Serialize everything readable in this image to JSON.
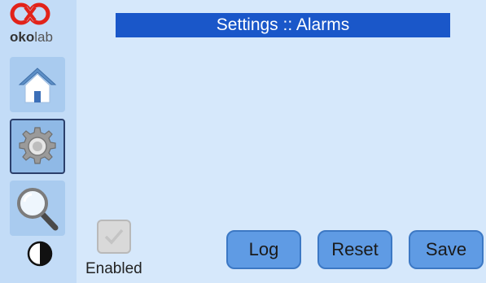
{
  "brand": {
    "name_bold": "oko",
    "name_light": "lab",
    "color": "#e2231a"
  },
  "header": {
    "title": "Settings :: Alarms"
  },
  "sidebar": {
    "items": [
      {
        "icon": "home-icon",
        "selected": false
      },
      {
        "icon": "gear-icon",
        "selected": true
      },
      {
        "icon": "magnifier-icon",
        "selected": false
      },
      {
        "icon": "contrast-icon",
        "selected": false
      }
    ]
  },
  "alarm": {
    "enabled_label": "Enabled",
    "enabled": true
  },
  "actions": {
    "log": "Log",
    "reset": "Reset",
    "save": "Save"
  },
  "colors": {
    "title_bar": "#1a57c9",
    "button": "#5f9be4",
    "background": "#d6e8fb"
  }
}
